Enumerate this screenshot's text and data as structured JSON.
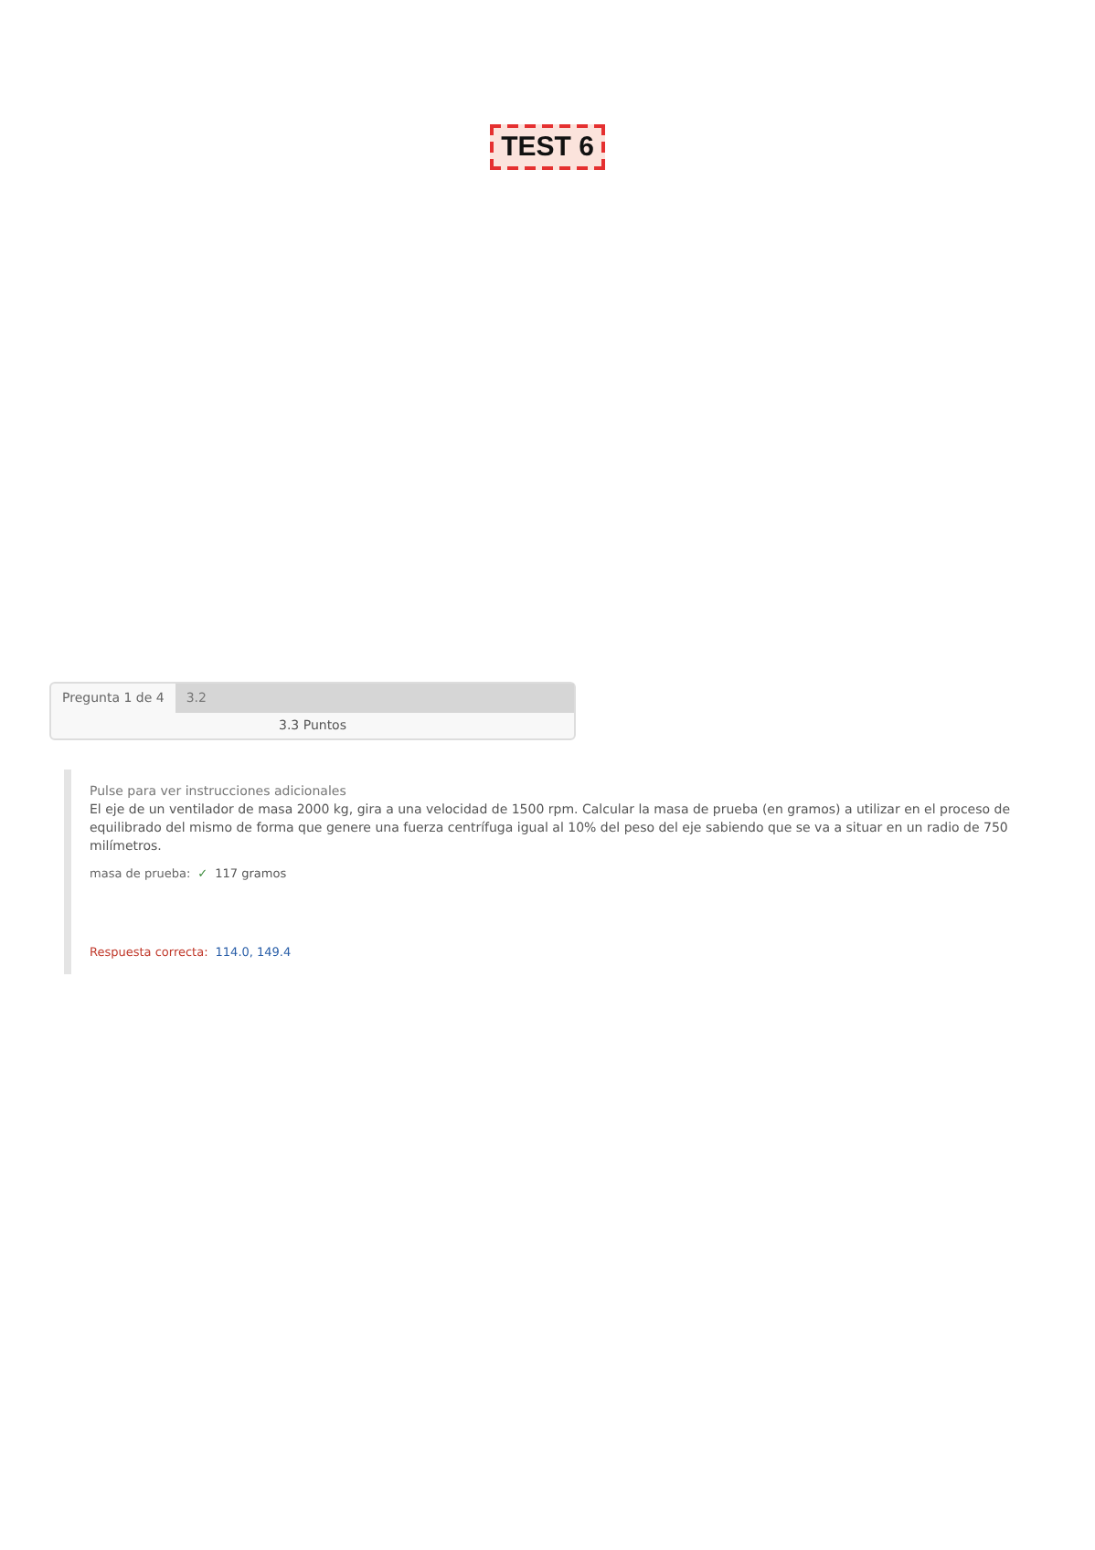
{
  "title": "TEST 6",
  "question_header": {
    "label": "Pregunta 1 de 4",
    "value": "3.2",
    "points": "3.3 Puntos"
  },
  "question": {
    "instructions_link": "Pulse para ver instrucciones adicionales",
    "text": "El eje de un ventilador de masa 2000 kg, gira a una velocidad de 1500 rpm. Calcular la masa de prueba (en gramos) a utilizar en el proceso de equilibrado del mismo de forma que genere una fuerza centrífuga igual al 10% del peso del eje sabiendo que se va a situar en un radio de 750 milímetros.",
    "answer_label": "masa de prueba:",
    "answer_mark": "✓",
    "answer_value": "117 gramos",
    "correct_label": "Respuesta correcta:",
    "correct_values": "114.0, 149.4"
  }
}
